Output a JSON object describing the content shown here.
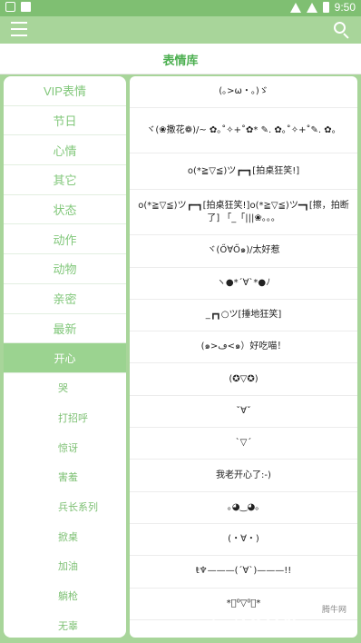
{
  "status": {
    "time": "9:50"
  },
  "header": {
    "title": "表情库"
  },
  "sidebar": {
    "categories": [
      "VIP表情",
      "节日",
      "心情",
      "其它",
      "状态",
      "动作",
      "动物",
      "亲密",
      "最新",
      "开心"
    ],
    "subcategories": [
      "哭",
      "打招呼",
      "惊讶",
      "害羞",
      "兵长系列",
      "掀桌",
      "加油",
      "躺枪",
      "无辜"
    ]
  },
  "emoticons": [
    "(｡>ω・｡)ゞ",
    "ヾ(❀撒花❁)/~ ✿｡˚✧+˚✿* ✎. ✿｡˚✧+˚✎. ✿。",
    "o(*≧▽≦)ツ┏━┓[拍桌狂笑!]",
    "o(*≧▽≦)ツ┏━┓[拍桌狂笑!]o(*≧▽≦)ツ━┓[擦，拍断了] 「_「|||❀。。。",
    "ヾ(Ő∀Ő๑)/太好惹",
    "ヽ●*´∀`*●ﾉ",
    "_┏┓○ツ[捶地狂笑]",
    "(๑>ڡ<๑）好吃喵！",
    "(✪▽✪)",
    "ˇ∀ˇ",
    "ˋ▽ˊ",
    "我老开心了:-)",
    "｡◕‿◕｡",
    "(・∀・)",
    "ŧ♆———(´∀`)———!!",
    "*ﾟ⁰▽⁰ﾟ*"
  ],
  "watermark": {
    "text": "QQTN",
    "cn": "腾牛网",
    "com": ".com"
  }
}
